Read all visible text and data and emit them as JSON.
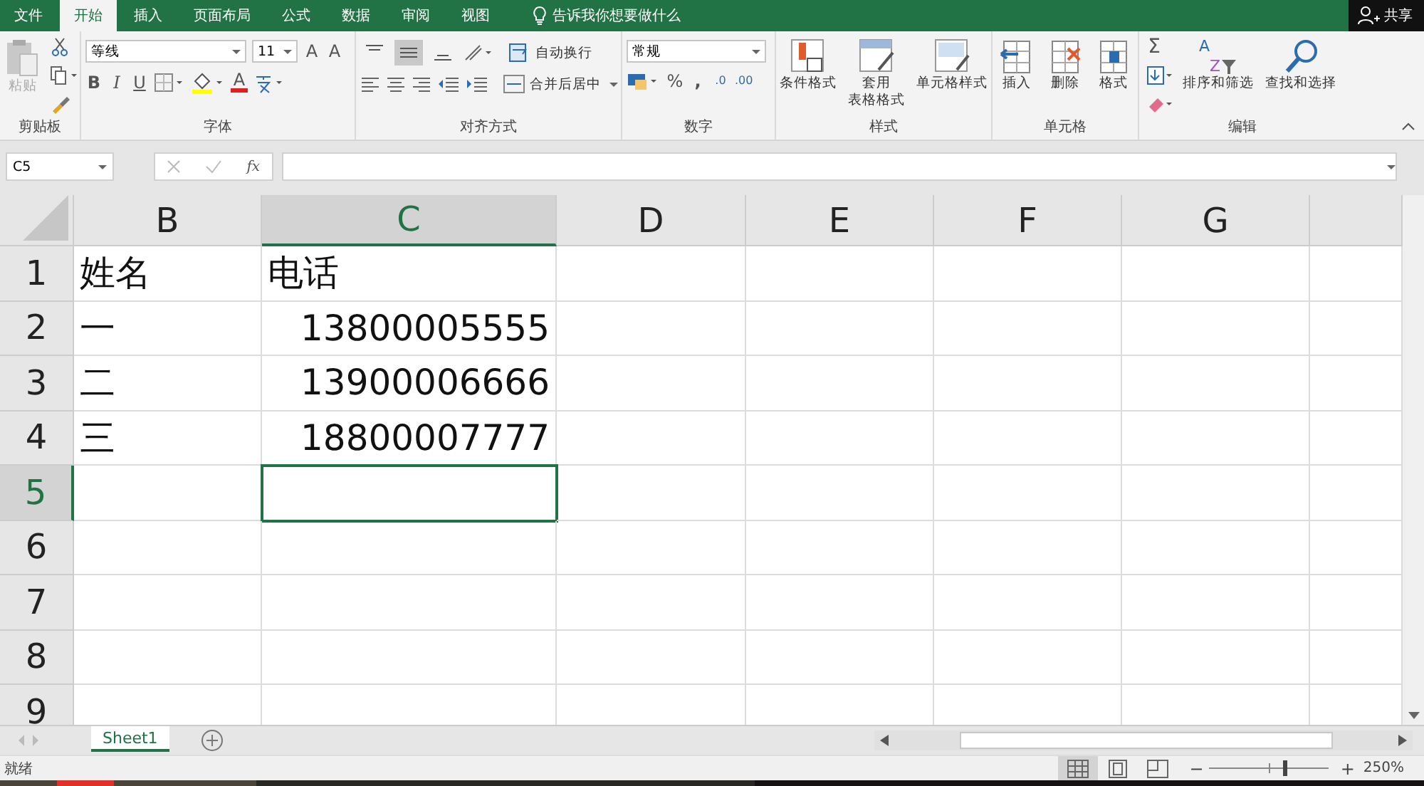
{
  "tabs": [
    {
      "label": "文件",
      "selected": false
    },
    {
      "label": "开始",
      "selected": true
    },
    {
      "label": "插入",
      "selected": false
    },
    {
      "label": "页面布局",
      "selected": false
    },
    {
      "label": "公式",
      "selected": false
    },
    {
      "label": "数据",
      "selected": false
    },
    {
      "label": "审阅",
      "selected": false
    },
    {
      "label": "视图",
      "selected": false
    }
  ],
  "tell_me": "告诉我你想要做什么",
  "share": "共享",
  "clipboard": {
    "label": "剪贴板",
    "paste": "粘贴",
    "paste_disabled": true
  },
  "font": {
    "label": "字体",
    "name": "等线",
    "size": "11",
    "grow": "A",
    "shrink": "A",
    "bold": "B",
    "italic": "I",
    "underline": "U",
    "font_color": "A"
  },
  "alignment": {
    "label": "对齐方式",
    "vertical": [
      {
        "selected": false
      },
      {
        "selected": true
      },
      {
        "selected": false
      }
    ],
    "wrap": "自动换行",
    "merge": "合并后居中"
  },
  "number": {
    "label": "数字",
    "format": "常规",
    "percent": "%",
    "comma": ",",
    "increase": ".0",
    "decrease": ".00"
  },
  "styles": {
    "label": "样式",
    "buttons": [
      {
        "lines": [
          "条件格式"
        ]
      },
      {
        "lines": [
          "套用",
          "表格格式"
        ]
      },
      {
        "lines": [
          "单元格样式"
        ]
      }
    ]
  },
  "cells": {
    "label": "单元格",
    "buttons": [
      "插入",
      "删除",
      "格式"
    ]
  },
  "editing": {
    "label": "编辑",
    "sum": "Σ",
    "sort_a": "A",
    "sort_z": "Z",
    "buttons": [
      "排序和筛选",
      "查找和选择"
    ]
  },
  "formula_bar": {
    "name_box": "C5",
    "fx": "fx"
  },
  "sheet": {
    "columns": [
      {
        "label": "B",
        "selected": false
      },
      {
        "label": "C",
        "selected": true
      },
      {
        "label": "D",
        "selected": false
      },
      {
        "label": "E",
        "selected": false
      },
      {
        "label": "F",
        "selected": false
      },
      {
        "label": "G",
        "selected": false
      }
    ],
    "rows": [
      {
        "label": "1",
        "selected": false,
        "cells": [
          {
            "text": "姓名",
            "kind": "text"
          },
          {
            "text": "电话",
            "kind": "text"
          }
        ]
      },
      {
        "label": "2",
        "selected": false,
        "cells": [
          {
            "text": "一",
            "kind": "text"
          },
          {
            "text": "13800005555",
            "kind": "number"
          }
        ]
      },
      {
        "label": "3",
        "selected": false,
        "cells": [
          {
            "text": "二",
            "kind": "text"
          },
          {
            "text": "13900006666",
            "kind": "number"
          }
        ]
      },
      {
        "label": "4",
        "selected": false,
        "cells": [
          {
            "text": "三",
            "kind": "text"
          },
          {
            "text": "18800007777",
            "kind": "number"
          }
        ]
      },
      {
        "label": "5",
        "selected": true,
        "cells": []
      },
      {
        "label": "6",
        "selected": false,
        "cells": []
      },
      {
        "label": "7",
        "selected": false,
        "cells": []
      },
      {
        "label": "8",
        "selected": false,
        "cells": []
      },
      {
        "label": "9",
        "selected": false,
        "cells": []
      }
    ]
  },
  "sheet_tabs": [
    {
      "name": "Sheet1",
      "selected": true
    }
  ],
  "status_bar": {
    "status": "就绪",
    "views": [
      {
        "selected": true
      },
      {
        "selected": false
      },
      {
        "selected": false
      }
    ],
    "zoom": {
      "out": "−",
      "in": "+",
      "level": 0.64,
      "reading": "250%"
    }
  }
}
